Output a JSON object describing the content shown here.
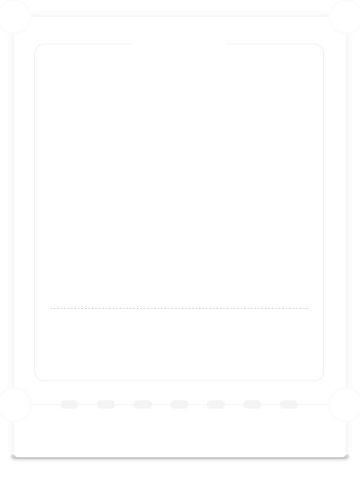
{
  "ticket": {
    "colors": {
      "card": "#ffffff",
      "panel_border": "#ececec",
      "divider": "#d9d9d9",
      "perforation": "#f4f4f4",
      "bottom_edge": "#c9c9c9"
    },
    "perforation_count": 7
  }
}
